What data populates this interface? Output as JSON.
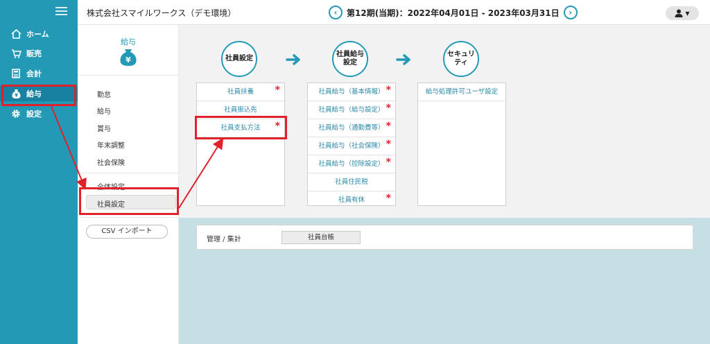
{
  "nav": {
    "items": [
      {
        "label": "ホーム",
        "icon": "home-icon"
      },
      {
        "label": "販売",
        "icon": "cart-icon"
      },
      {
        "label": "会計",
        "icon": "calculator-icon"
      },
      {
        "label": "給与",
        "icon": "money-bag-icon"
      },
      {
        "label": "設定",
        "icon": "gear-icon"
      }
    ],
    "active": "給与"
  },
  "header": {
    "company": "株式会社スマイルワークス（デモ環境）",
    "period": "第12期(当期)：2022年04月01日 - 2023年03月31日",
    "prev_icon": "chevron-left-icon",
    "next_icon": "chevron-right-icon",
    "user_icon": "user-icon"
  },
  "submenu": {
    "title": "給与",
    "items": [
      "勤怠",
      "給与",
      "賞与",
      "年末調整",
      "社会保険"
    ],
    "settings": [
      "全体設定",
      "社員設定"
    ],
    "selected": "社員設定",
    "csv_button": "CSV インポート"
  },
  "flow": {
    "steps": [
      "社員設定",
      "社員給与\n設定",
      "セキュリティ"
    ]
  },
  "panels": [
    {
      "items": [
        {
          "label": "社員扶養",
          "required": true
        },
        {
          "label": "社員振込先",
          "required": false
        },
        {
          "label": "社員支払方法",
          "required": true
        }
      ]
    },
    {
      "items": [
        {
          "label": "社員給与（基本情報）",
          "required": true
        },
        {
          "label": "社員給与（給与設定）",
          "required": true
        },
        {
          "label": "社員給与（通勤費等）",
          "required": true
        },
        {
          "label": "社員給与（社会保険）",
          "required": true
        },
        {
          "label": "社員給与（控除設定）",
          "required": true
        },
        {
          "label": "社員住民税",
          "required": false
        },
        {
          "label": "社員有休",
          "required": true
        }
      ]
    },
    {
      "items": [
        {
          "label": "給与処理許可ユーザ設定",
          "required": false
        }
      ]
    }
  ],
  "management": {
    "label": "管理 / 集計",
    "button": "社員台帳"
  },
  "colors": {
    "nav_bg": "#2399b6",
    "accent": "#2399b6",
    "link": "#2a88a8",
    "required_star": "#e0202a",
    "annotation": "#e0202a",
    "bottom_bg": "#c6dfe5"
  },
  "required_mark": "*"
}
